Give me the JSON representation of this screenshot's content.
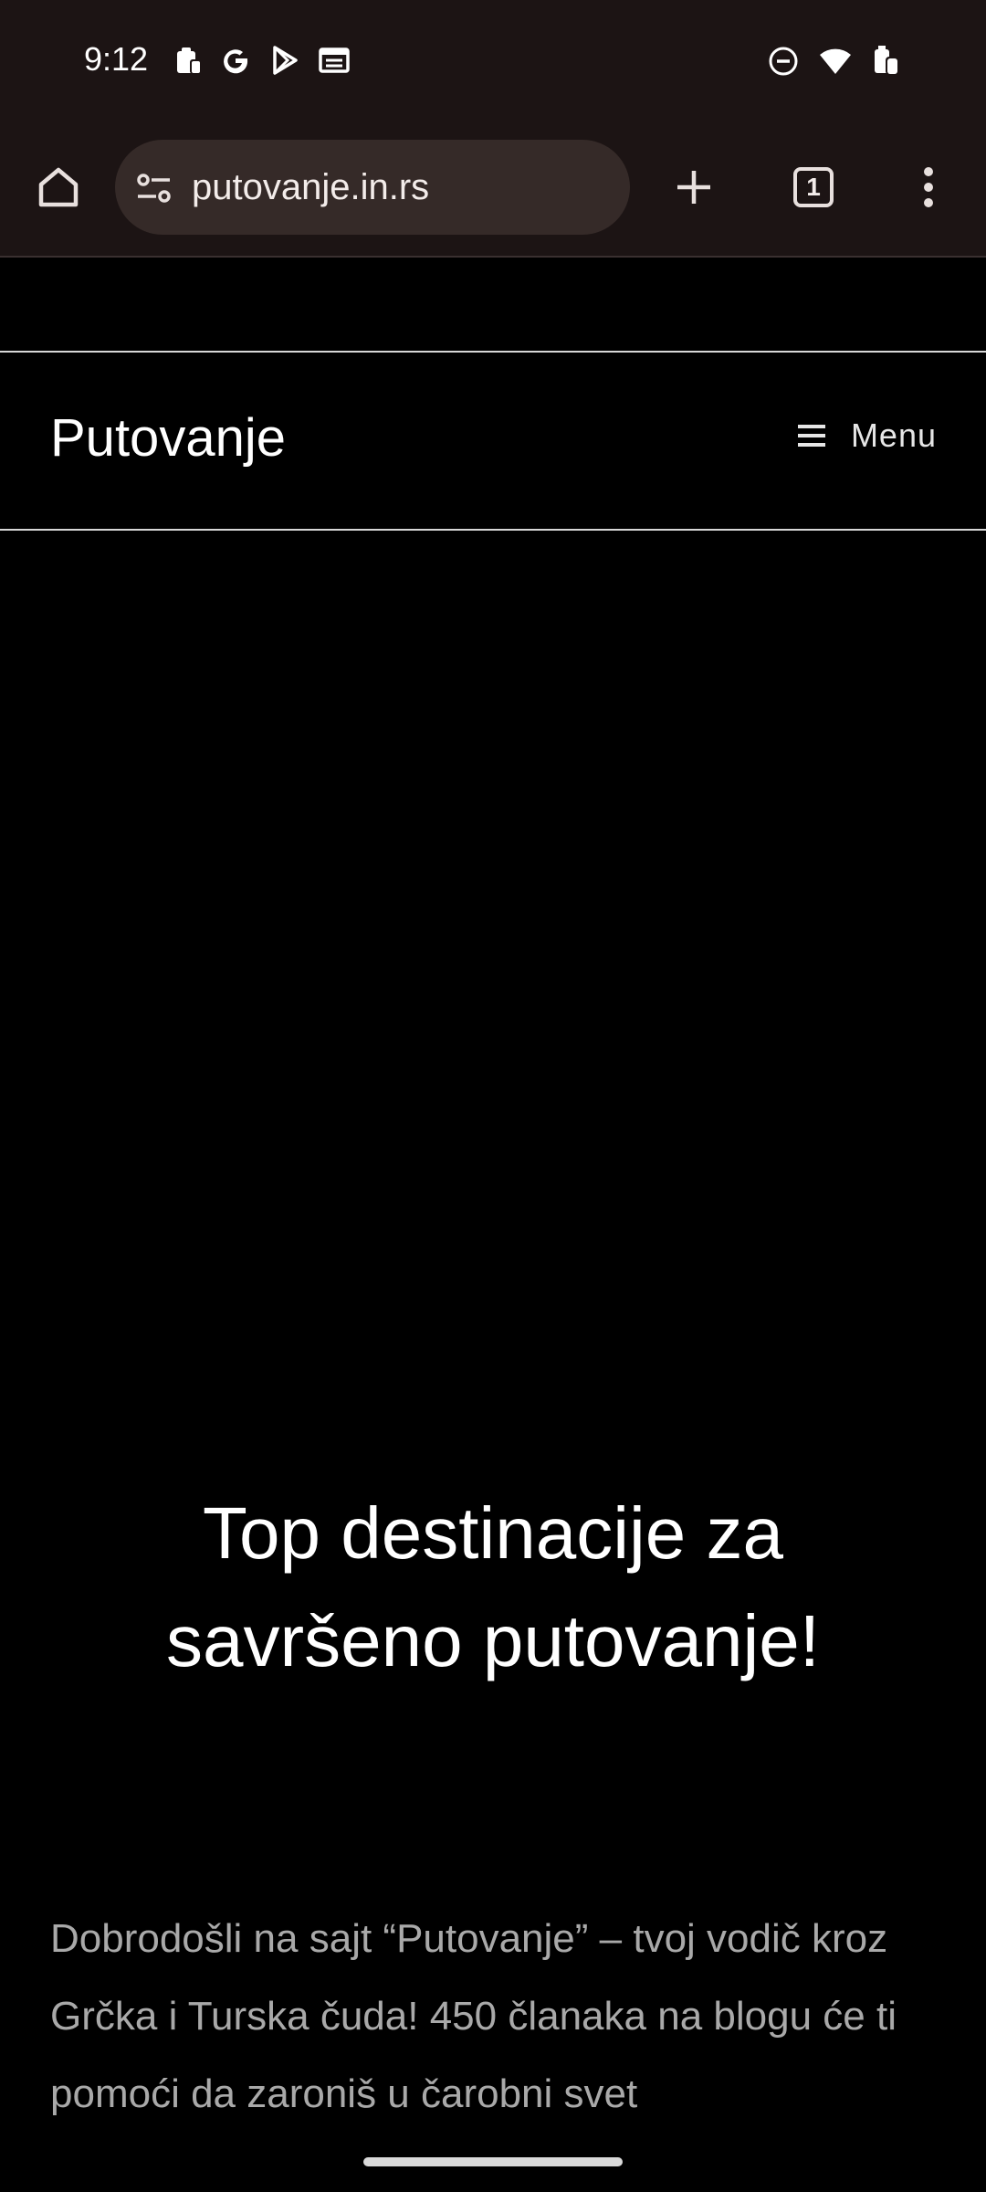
{
  "status_bar": {
    "time": "9:12",
    "left_icons": [
      "clipboard-icon",
      "google-icon",
      "play-store-icon",
      "news-icon"
    ],
    "right_icons": [
      "dnd-icon",
      "wifi-icon",
      "battery-icon"
    ]
  },
  "browser": {
    "url": "putovanje.in.rs",
    "tab_count": "1"
  },
  "site": {
    "title": "Putovanje",
    "menu_label": "Menu"
  },
  "hero": {
    "title": "Top destinacije za savršeno putovanje!"
  },
  "intro": {
    "text": "Dobrodošli na sajt “Putovanje” – tvoj vodič kroz Grčka i Turska čuda! 450 članaka na blogu će ti pomoći da zaroniš u čarobni svet"
  },
  "colors": {
    "chrome_bg": "#1c1414",
    "url_pill": "#352a28",
    "page_bg": "#000000",
    "body_text": "#a9a9a9"
  }
}
